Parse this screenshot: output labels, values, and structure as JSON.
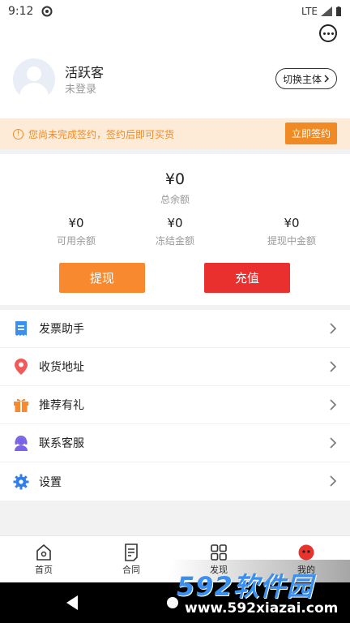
{
  "status_bar": {
    "time": "9:12",
    "network": "LTE"
  },
  "profile": {
    "name": "活跃客",
    "login_status": "未登录",
    "switch_label": "切换主体"
  },
  "notice": {
    "text": "您尚未完成签约，签约后即可买货",
    "button": "立即签约"
  },
  "balance": {
    "total_amount": "¥0",
    "total_label": "总余额",
    "items": [
      {
        "amount": "¥0",
        "label": "可用余额"
      },
      {
        "amount": "¥0",
        "label": "冻结金额"
      },
      {
        "amount": "¥0",
        "label": "提现中金额"
      }
    ],
    "withdraw_label": "提现",
    "recharge_label": "充值"
  },
  "menu": [
    {
      "label": "发票助手",
      "icon": "invoice-icon"
    },
    {
      "label": "收货地址",
      "icon": "location-pin-icon"
    },
    {
      "label": "推荐有礼",
      "icon": "gift-icon"
    },
    {
      "label": "联系客服",
      "icon": "customer-service-icon"
    },
    {
      "label": "设置",
      "icon": "gear-icon"
    }
  ],
  "tabbar": [
    {
      "label": "首页",
      "icon": "home-icon"
    },
    {
      "label": "合同",
      "icon": "contract-icon"
    },
    {
      "label": "发现",
      "icon": "grid-icon"
    },
    {
      "label": "我的",
      "icon": "profile-icon"
    }
  ],
  "watermark": {
    "title": "592软件园",
    "url": "www.592xiazai.com"
  },
  "colors": {
    "accent_orange": "#f8892f",
    "accent_red": "#ea2f2f",
    "notice_bg": "#fdebd7"
  }
}
